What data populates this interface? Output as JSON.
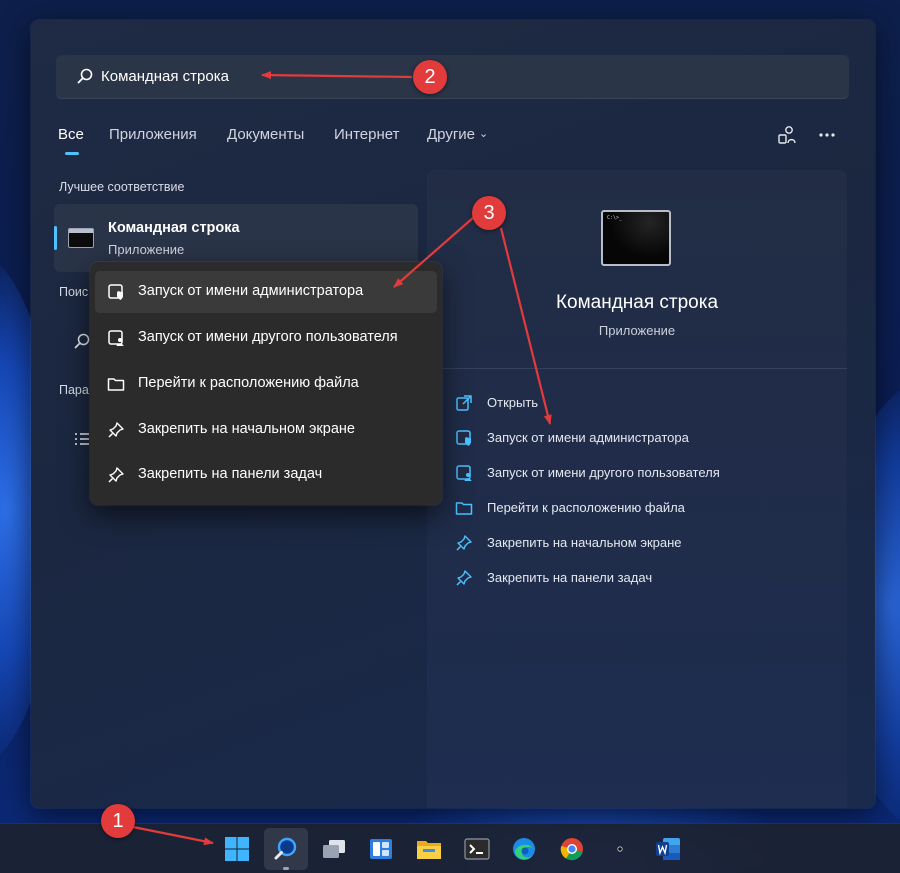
{
  "search": {
    "query": "Командная строка",
    "icon": "search-icon"
  },
  "tabs": [
    {
      "label": "Все",
      "active": true
    },
    {
      "label": "Приложения"
    },
    {
      "label": "Документы"
    },
    {
      "label": "Интернет"
    },
    {
      "label": "Другие",
      "icon": "chevron-down-icon"
    }
  ],
  "top_icons": [
    "account-switch-icon",
    "more-icon"
  ],
  "left": {
    "best_match_title": "Лучшее соответствие",
    "best_match": {
      "name": "Командная строка",
      "type": "Приложение",
      "icon": "command-prompt-icon"
    },
    "web_search_title_fragment": "Поис",
    "settings_title_fragment": "Пара"
  },
  "preview": {
    "app_name": "Командная строка",
    "app_type": "Приложение",
    "icon": "command-prompt-icon",
    "actions": [
      {
        "label": "Открыть",
        "icon": "open-external-icon"
      },
      {
        "label": "Запуск от имени администратора",
        "icon": "shield-run-icon"
      },
      {
        "label": "Запуск от имени другого пользователя",
        "icon": "user-run-icon"
      },
      {
        "label": "Перейти к расположению файла",
        "icon": "folder-icon"
      },
      {
        "label": "Закрепить на начальном экране",
        "icon": "pin-icon"
      },
      {
        "label": "Закрепить на панели задач",
        "icon": "pin-icon"
      }
    ]
  },
  "context_menu": {
    "items": [
      {
        "label": "Запуск от имени администратора",
        "icon": "shield-run-icon",
        "highlighted": true
      },
      {
        "label": "Запуск от имени другого пользователя",
        "icon": "user-run-icon"
      },
      {
        "label": "Перейти к расположению файла",
        "icon": "folder-icon"
      },
      {
        "label": "Закрепить на начальном экране",
        "icon": "pin-icon"
      },
      {
        "label": "Закрепить на панели задач",
        "icon": "pin-icon"
      }
    ]
  },
  "taskbar": {
    "items": [
      {
        "icon": "windows-start-icon"
      },
      {
        "icon": "search-icon",
        "active": true
      },
      {
        "icon": "task-view-icon"
      },
      {
        "icon": "widgets-icon"
      },
      {
        "icon": "file-explorer-icon"
      },
      {
        "icon": "terminal-icon"
      },
      {
        "icon": "edge-browser-icon"
      },
      {
        "icon": "chrome-browser-icon"
      },
      {
        "icon": "app-icon"
      },
      {
        "icon": "word-icon"
      }
    ]
  },
  "annotations": {
    "badges": [
      "1",
      "2",
      "3"
    ]
  },
  "colors": {
    "accent": "#4cc2ff",
    "annotation_red": "#e23b3b",
    "panel": "#1f2b44",
    "menu": "#2b2b2b"
  }
}
